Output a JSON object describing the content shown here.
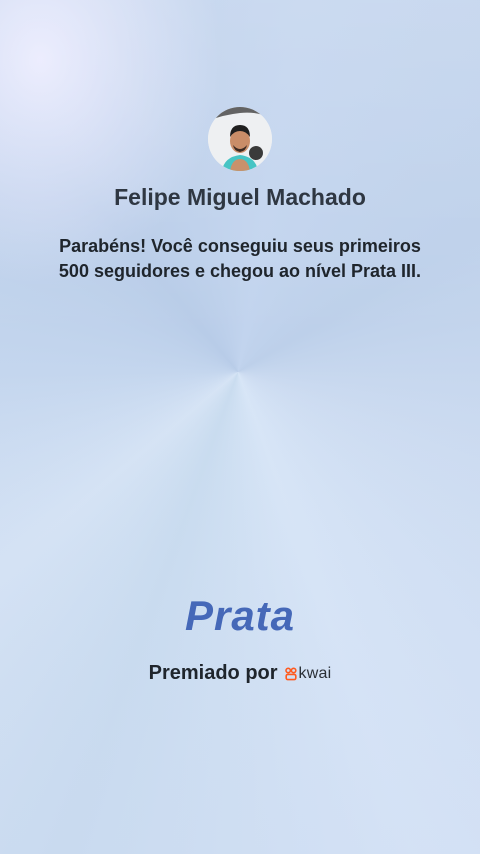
{
  "profile": {
    "name": "Felipe Miguel Machado",
    "avatar_icon": "user-photo"
  },
  "message": "Parabéns! Você conseguiu seus primeiros 500 seguidores e chegou ao nível Prata III.",
  "level": {
    "label": "Prata",
    "color": "#4568b8"
  },
  "footer": {
    "awarded_by": "Premiado por",
    "brand": "kwai",
    "brand_color": "#ff5a1f"
  }
}
